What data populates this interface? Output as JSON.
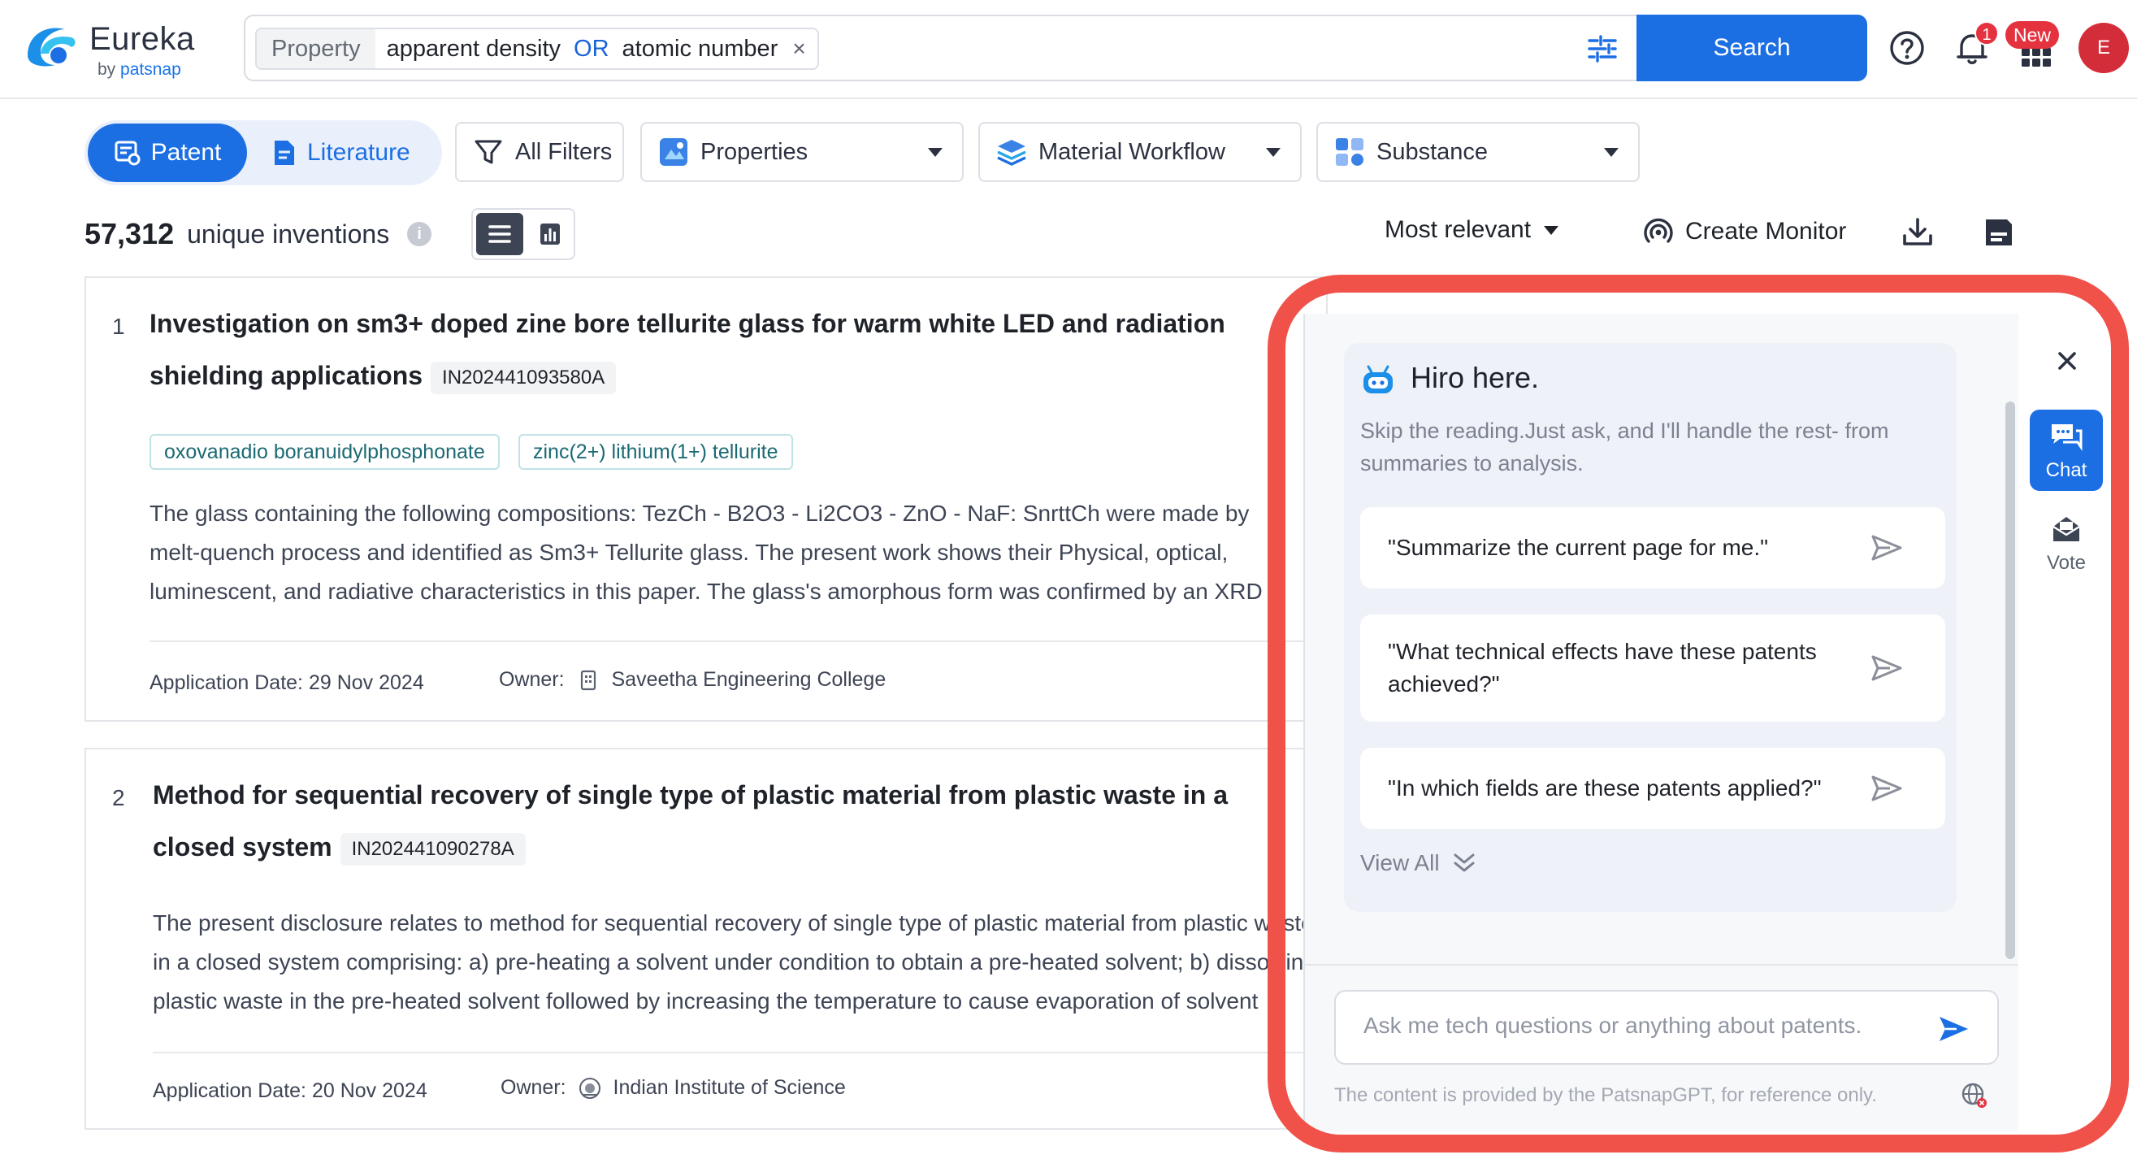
{
  "brand": {
    "name": "Eureka",
    "sub_prefix": "by ",
    "sub_brand": "patsnap"
  },
  "search": {
    "chip_field": "Property",
    "term1": "apparent density",
    "operator": "OR",
    "term2": "atomic number",
    "remove_symbol": "×",
    "button_label": "Search"
  },
  "header": {
    "notification_count": "1",
    "apps_badge": "New",
    "avatar_initial": "E"
  },
  "toolbar": {
    "patent_label": "Patent",
    "literature_label": "Literature",
    "all_filters_label": "All Filters",
    "properties_label": "Properties",
    "material_workflow_label": "Material Workflow",
    "substance_label": "Substance"
  },
  "results_bar": {
    "count": "57,312",
    "count_label": "unique inventions",
    "info_symbol": "i",
    "sort_label": "Most relevant",
    "monitor_label": "Create Monitor"
  },
  "results": [
    {
      "index": "1",
      "title_line1": "Investigation on sm3+ doped zine bore tellurite glass for warm white LED and radiation",
      "title_line2": "shielding applications",
      "pub_no": "IN202441093580A",
      "tags": [
        "oxovanadio boranuidylphosphonate",
        "zinc(2+) lithium(1+) tellurite"
      ],
      "abstract_lines": [
        "The glass containing the following compositions: TezCh - B2O3 - Li2CO3 - ZnO - NaF: SnrttCh were made by",
        "melt-quench process and identified as Sm3+ Tellurite glass. The present work shows their Physical, optical,",
        "luminescent, and radiative characteristics in this paper. The glass's amorphous form was confirmed by an XRD"
      ],
      "app_date": "Application Date: 29 Nov 2024",
      "owner_label": "Owner:",
      "owner": "Saveetha Engineering College"
    },
    {
      "index": "2",
      "title_line1": "Method for sequential recovery of single type of plastic material from plastic waste in a",
      "title_line2": "closed system",
      "pub_no": "IN202441090278A",
      "abstract_lines": [
        "The present disclosure relates to method for sequential recovery of single type of plastic material from plastic waste",
        "in a closed system comprising: a) pre-heating a solvent under condition to obtain a pre-heated solvent; b) dissolving",
        "plastic waste in the pre-heated solvent followed by increasing the temperature to cause evaporation of solvent"
      ],
      "app_date": "Application Date: 20 Nov 2024",
      "owner_label": "Owner:",
      "owner": "Indian Institute of Science"
    }
  ],
  "hiro": {
    "title": "Hiro here.",
    "subtitle": "Skip the reading.Just ask, and I'll handle the rest- from summaries to analysis.",
    "prompts": [
      "\"Summarize the current page for me.\"",
      "\"What technical effects have these patents achieved?\"",
      "\"In which fields are these patents applied?\""
    ],
    "view_all_label": "View All",
    "input_placeholder": "Ask me tech questions or anything about patents.",
    "disclaimer": "The content is provided by the PatsnapGPT, for reference only."
  },
  "rail": {
    "chat_label": "Chat",
    "vote_label": "Vote"
  },
  "colors": {
    "primary": "#1c6fe3",
    "highlight_outline": "#f0524a",
    "badge_red": "#e5323f",
    "tag_border": "#bfe3e6"
  }
}
